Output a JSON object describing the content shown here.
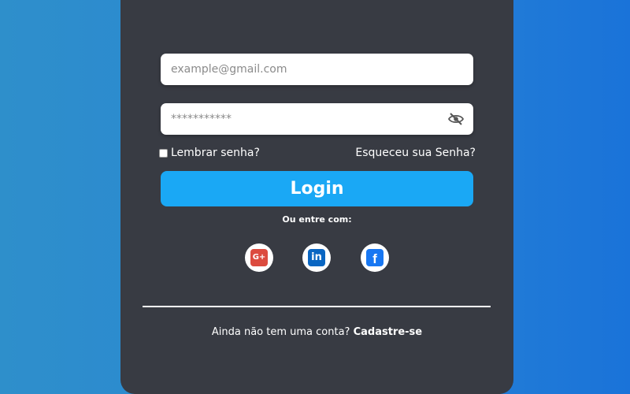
{
  "form": {
    "email_placeholder": "example@gmail.com",
    "password_placeholder": "***********",
    "remember_label": "Lembrar senha?",
    "forgot_label": "Esqueceu sua Senha?",
    "login_label": "Login",
    "or_label": "Ou entre com:"
  },
  "social": {
    "google_label": "G+",
    "linkedin_label": "in",
    "facebook_label": "f"
  },
  "signup": {
    "question": "Ainda não tem uma conta?",
    "link_label": "Cadastre-se"
  },
  "colors": {
    "card": "#383b43",
    "login_button": "#1aa8f5",
    "google": "#dc4b3f",
    "linkedin": "#0a66c2",
    "facebook": "#1877f2"
  },
  "icons": {
    "password_toggle": "eye-slash-icon",
    "google": "google-plus-icon",
    "linkedin": "linkedin-icon",
    "facebook": "facebook-icon"
  }
}
